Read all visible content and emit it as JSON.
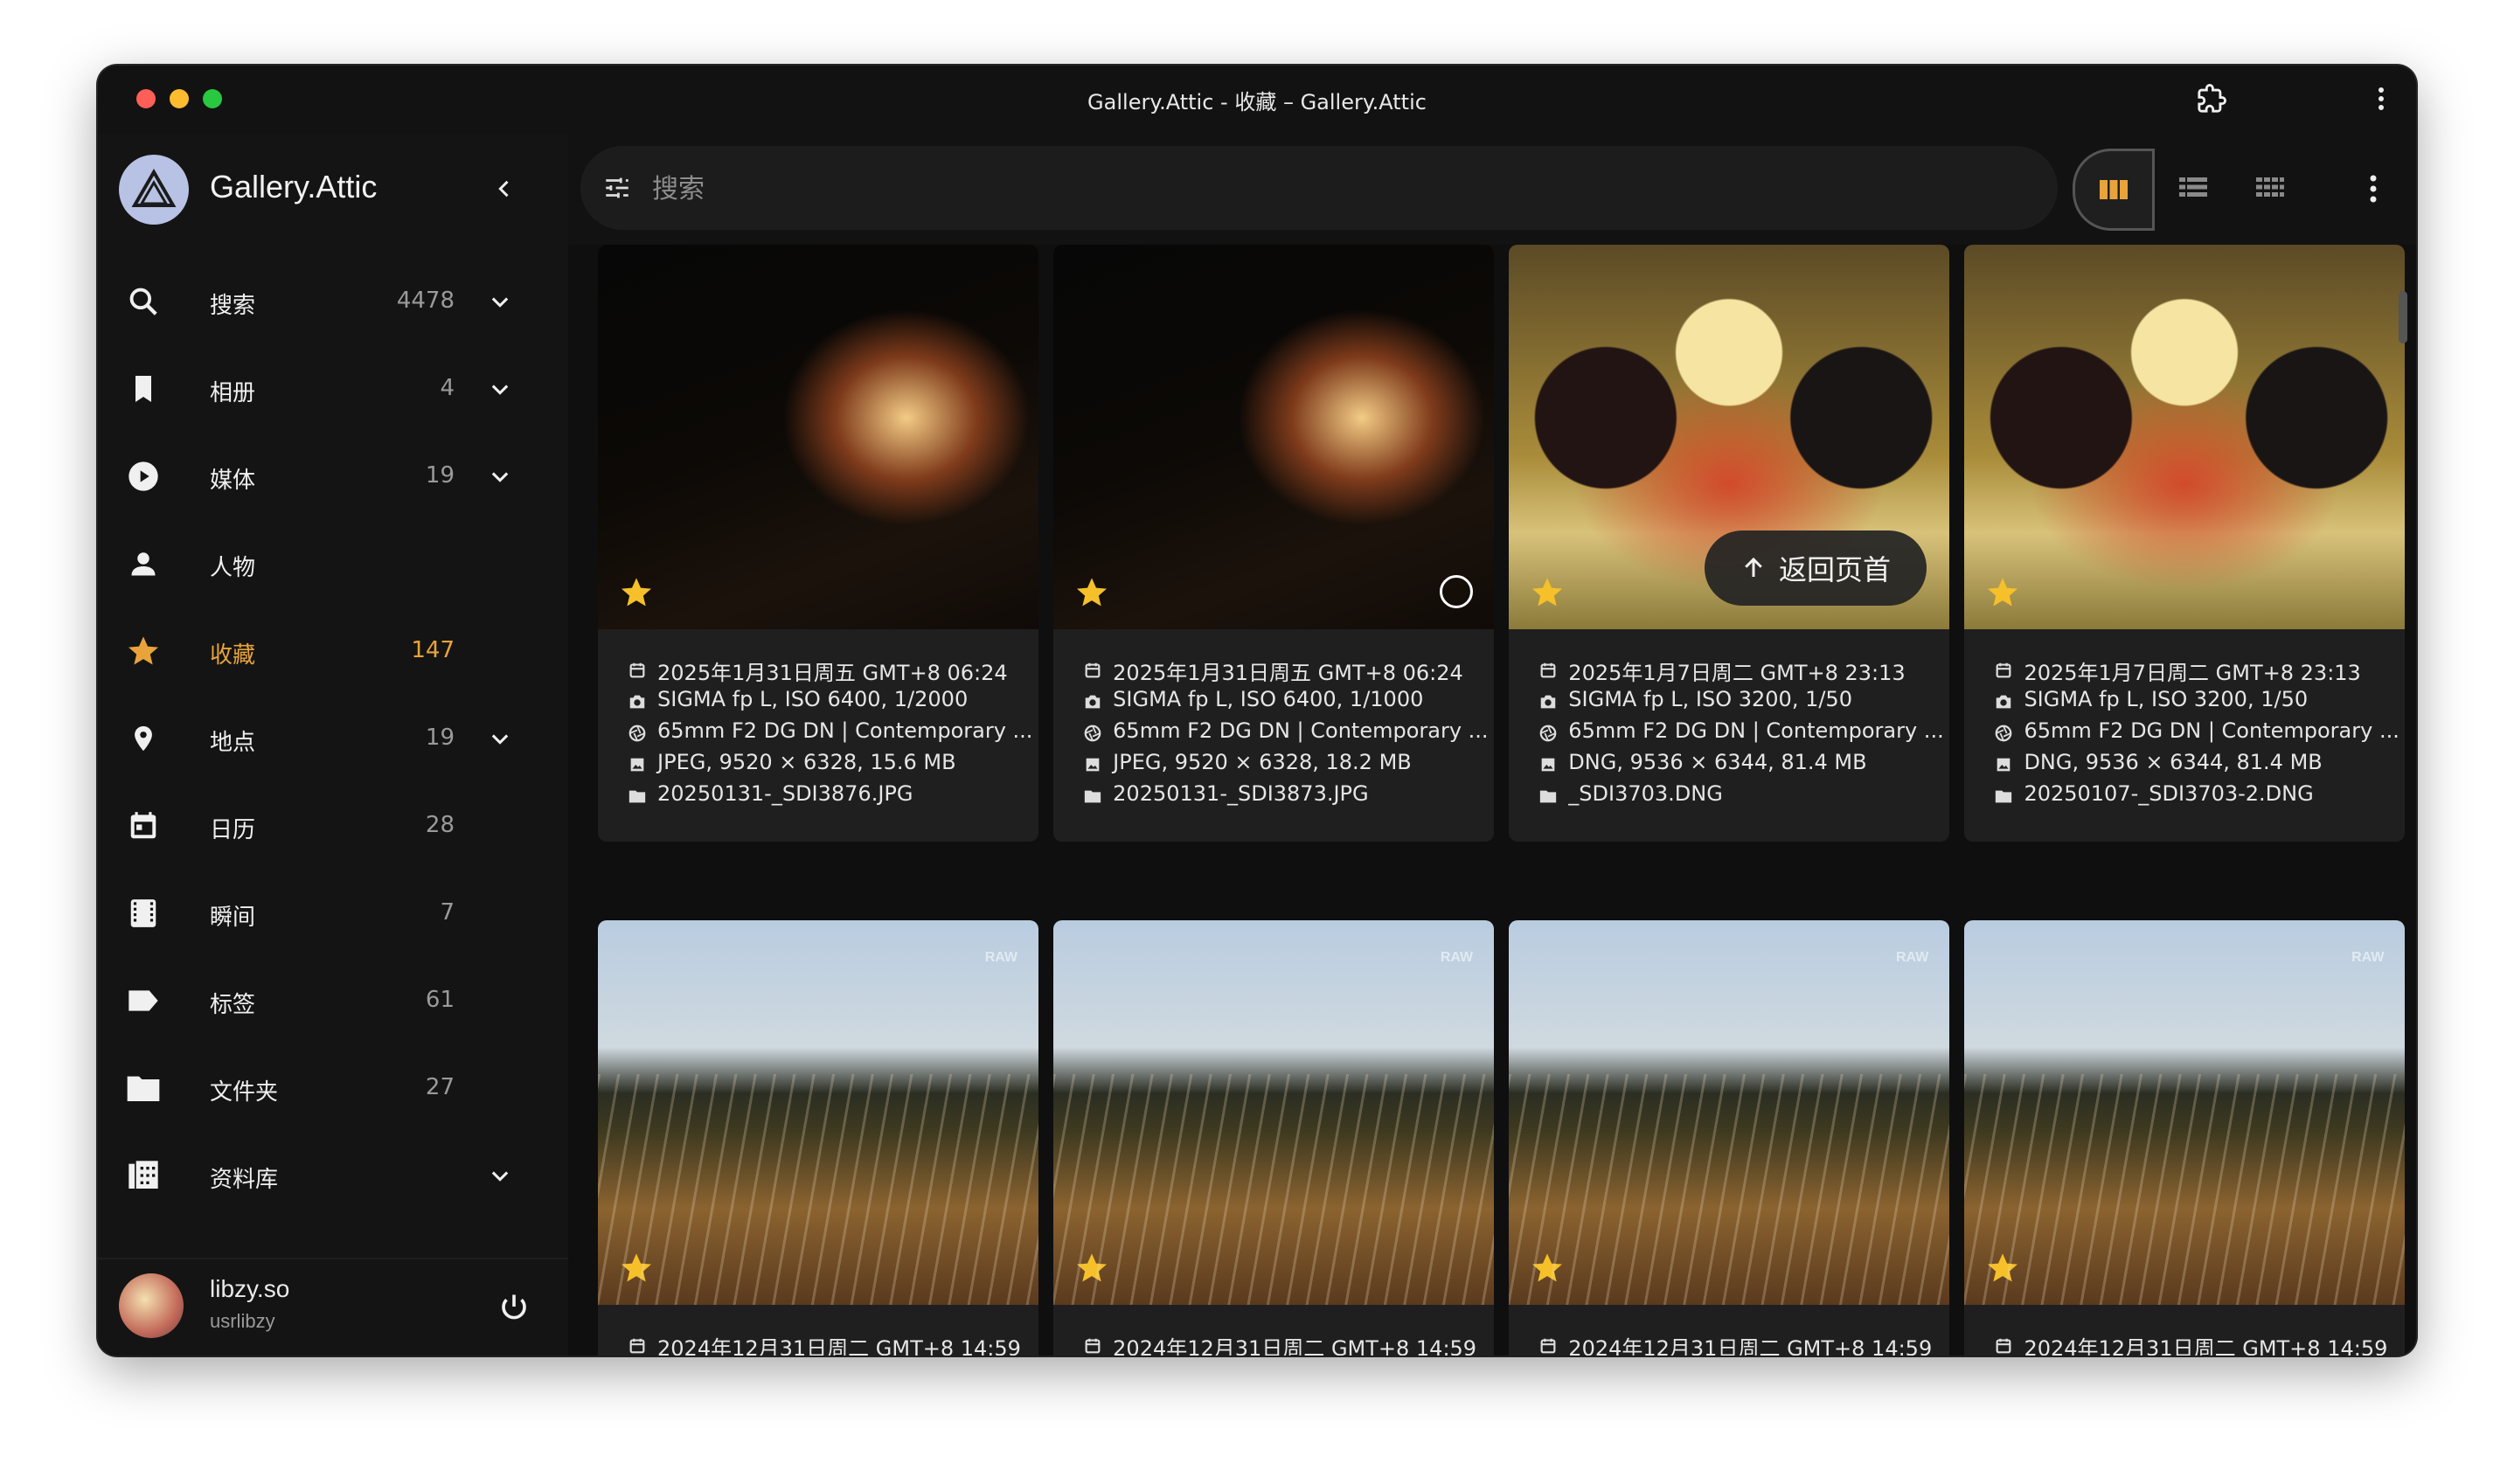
{
  "window": {
    "title": "Gallery.Attic - 收藏 – Gallery.Attic",
    "traffic": [
      "#ff5f57",
      "#febc2e",
      "#28c840"
    ]
  },
  "sidebar": {
    "brand": "Gallery.Attic",
    "accent": "#e8a43a",
    "items": [
      {
        "label": "搜索",
        "count": "4478",
        "icon": "search-icon",
        "expandable": true
      },
      {
        "label": "相册",
        "count": "4",
        "icon": "bookmark-icon",
        "expandable": true
      },
      {
        "label": "媒体",
        "count": "19",
        "icon": "play-circle-icon",
        "expandable": true
      },
      {
        "label": "人物",
        "count": "",
        "icon": "person-icon",
        "expandable": false
      },
      {
        "label": "收藏",
        "count": "147",
        "icon": "star-icon",
        "expandable": false,
        "active": true
      },
      {
        "label": "地点",
        "count": "19",
        "icon": "location-pin-icon",
        "expandable": true
      },
      {
        "label": "日历",
        "count": "28",
        "icon": "calendar-icon",
        "expandable": false
      },
      {
        "label": "瞬间",
        "count": "7",
        "icon": "film-icon",
        "expandable": false
      },
      {
        "label": "标签",
        "count": "61",
        "icon": "label-icon",
        "expandable": false
      },
      {
        "label": "文件夹",
        "count": "27",
        "icon": "folder-icon",
        "expandable": false
      },
      {
        "label": "资料库",
        "count": "",
        "icon": "library-icon",
        "expandable": true
      }
    ],
    "user": {
      "name": "libzy.so",
      "handle": "usrlibzy"
    }
  },
  "search": {
    "placeholder": "搜索"
  },
  "view_modes": [
    "cards-view",
    "list-view",
    "mosaic-view"
  ],
  "back_to_top": "返回页首",
  "photos": [
    {
      "date": "2025年1月31日周五 GMT+8 06:24",
      "camera": "SIGMA fp L, ISO 6400, 1/2000",
      "lens": "65mm F2 DG DN | Contemporary ...",
      "file": "JPEG, 9520 × 6328, 15.6 MB",
      "name": "20250131-_SDI3876.JPG",
      "kind": "night",
      "raw": false,
      "select": false
    },
    {
      "date": "2025年1月31日周五 GMT+8 06:24",
      "camera": "SIGMA fp L, ISO 6400, 1/1000",
      "lens": "65mm F2 DG DN | Contemporary ...",
      "file": "JPEG, 9520 × 6328, 18.2 MB",
      "name": "20250131-_SDI3873.JPG",
      "kind": "night",
      "raw": false,
      "select": true
    },
    {
      "date": "2025年1月7日周二 GMT+8 23:13",
      "camera": "SIGMA fp L, ISO 3200, 1/50",
      "lens": "65mm F2 DG DN | Contemporary ...",
      "file": "DNG, 9536 × 6344, 81.4 MB",
      "name": "_SDI3703.DNG",
      "kind": "toy",
      "raw": false,
      "select": false
    },
    {
      "date": "2025年1月7日周二 GMT+8 23:13",
      "camera": "SIGMA fp L, ISO 3200, 1/50",
      "lens": "65mm F2 DG DN | Contemporary ...",
      "file": "DNG, 9536 × 6344, 81.4 MB",
      "name": "20250107-_SDI3703-2.DNG",
      "kind": "toy",
      "raw": false,
      "select": false
    },
    {
      "date": "2024年12月31日周二 GMT+8 14:59",
      "camera": "",
      "lens": "",
      "file": "",
      "name": "",
      "kind": "grass",
      "raw": true,
      "raw_label": "RAW",
      "select": false
    },
    {
      "date": "2024年12月31日周二 GMT+8 14:59",
      "camera": "",
      "lens": "",
      "file": "",
      "name": "",
      "kind": "grass",
      "raw": true,
      "raw_label": "RAW",
      "select": false
    },
    {
      "date": "2024年12月31日周二 GMT+8 14:59",
      "camera": "",
      "lens": "",
      "file": "",
      "name": "",
      "kind": "grass",
      "raw": true,
      "raw_label": "RAW",
      "select": false
    },
    {
      "date": "2024年12月31日周二 GMT+8 14:59",
      "camera": "",
      "lens": "",
      "file": "",
      "name": "",
      "kind": "grass",
      "raw": true,
      "raw_label": "RAW",
      "select": false
    }
  ]
}
